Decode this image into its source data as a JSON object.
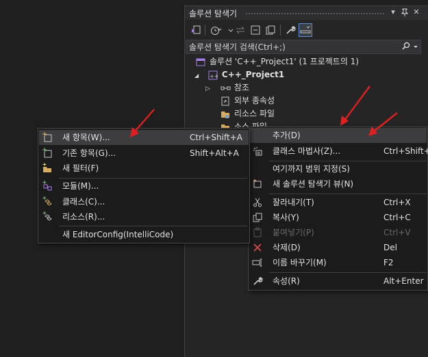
{
  "solution_explorer": {
    "title": "솔루션 탐색기",
    "title_buttons": {
      "dropdown": "▾",
      "pin": "⊥",
      "close": "✕"
    },
    "search": {
      "placeholder": "솔루션 탐색기 검색(Ctrl+;)"
    },
    "tree": {
      "solution": "솔루션 'C++_Project1' (1 프로젝트의 1)",
      "project": "C++_Project1",
      "references": "참조",
      "external_deps": "외부 종속성",
      "resource_files": "리소스 파일",
      "source_files": "소스 파일"
    }
  },
  "context_menu": {
    "items": [
      {
        "label": "추가(D)",
        "shortcut": "",
        "icon": "none",
        "highlighted": true,
        "disabled": false
      },
      {
        "label": "클래스 마법사(Z)...",
        "shortcut": "Ctrl+Shift+X",
        "icon": "class-wizard-icon",
        "disabled": false
      },
      {
        "label": "여기까지 범위 지정(S)",
        "shortcut": "",
        "icon": "none",
        "disabled": false
      },
      {
        "label": "새 솔루션 탐색기 뷰(N)",
        "shortcut": "",
        "icon": "new-view-icon",
        "disabled": false
      },
      {
        "label": "잘라내기(T)",
        "shortcut": "Ctrl+X",
        "icon": "scissors-icon",
        "disabled": false
      },
      {
        "label": "복사(Y)",
        "shortcut": "Ctrl+C",
        "icon": "copy-icon",
        "disabled": false
      },
      {
        "label": "붙여넣기(P)",
        "shortcut": "Ctrl+V",
        "icon": "paste-icon",
        "disabled": true
      },
      {
        "label": "삭제(D)",
        "shortcut": "Del",
        "icon": "delete-icon",
        "disabled": false
      },
      {
        "label": "이름 바꾸기(M)",
        "shortcut": "F2",
        "icon": "rename-icon",
        "disabled": false
      },
      {
        "label": "속성(R)",
        "shortcut": "Alt+Enter",
        "icon": "wrench-icon",
        "disabled": false
      }
    ]
  },
  "add_submenu": {
    "items": [
      {
        "label": "새 항목(W)...",
        "shortcut": "Ctrl+Shift+A",
        "icon": "new-item-icon",
        "highlighted": true
      },
      {
        "label": "기존 항목(G)...",
        "shortcut": "Shift+Alt+A",
        "icon": "existing-item-icon"
      },
      {
        "label": "새 필터(F)",
        "shortcut": "",
        "icon": "new-filter-icon"
      },
      {
        "label": "모듈(M)...",
        "shortcut": "",
        "icon": "module-icon"
      },
      {
        "label": "클래스(C)...",
        "shortcut": "",
        "icon": "class-icon"
      },
      {
        "label": "리소스(R)...",
        "shortcut": "",
        "icon": "resource-icon"
      },
      {
        "label": "새 EditorConfig(IntelliCode)",
        "shortcut": "",
        "icon": "none"
      }
    ]
  },
  "colors": {
    "arrow": "#e02020",
    "accent": "#5a8fd6",
    "delete": "#e05050"
  }
}
